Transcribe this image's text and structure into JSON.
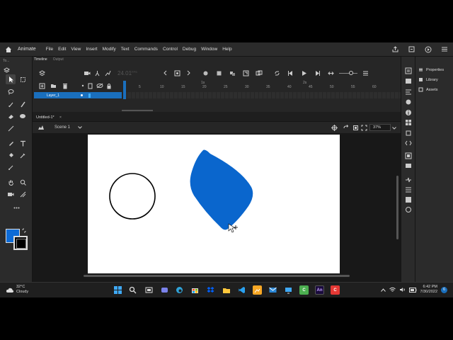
{
  "app": {
    "name": "Animate"
  },
  "menu": [
    "File",
    "Edit",
    "View",
    "Insert",
    "Modify",
    "Text",
    "Commands",
    "Control",
    "Debug",
    "Window",
    "Help"
  ],
  "tools_panel": {
    "label": "To..."
  },
  "timeline": {
    "tabs": [
      "Timeline",
      "Output"
    ],
    "fps": "24.01",
    "fps_unit": "FPS",
    "ruler": [
      "1s",
      "2s",
      "5",
      "10",
      "15",
      "20",
      "25",
      "30",
      "35",
      "40",
      "45",
      "50",
      "55",
      "60"
    ],
    "layer_name": "Layer_1"
  },
  "document": {
    "tab_title": "Untitled-1*",
    "close": "×",
    "scene": "Scene 1",
    "zoom": "37%"
  },
  "right_panels": [
    "Properties",
    "Library",
    "Assets"
  ],
  "colors": {
    "fill": "#0d6bd6",
    "stroke": "#000000",
    "shape_fill": "#0a66cd",
    "accent": "#1a6fbd"
  },
  "taskbar": {
    "weather_temp": "32°C",
    "weather_desc": "Cloudy",
    "time": "6:42 PM",
    "date": "7/30/2022",
    "notification_count": "6"
  }
}
